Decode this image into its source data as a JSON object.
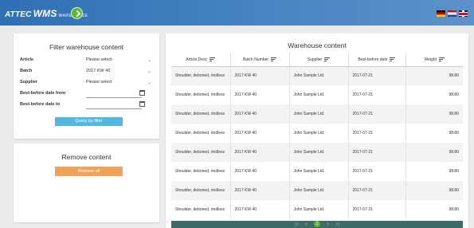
{
  "header": {
    "brand": "ATTEC",
    "brand2": "WMS",
    "brand_sub": "WAREHOUSE",
    "colors": {
      "bar": "#2f6fb3",
      "nav_button": "#5cb82f"
    },
    "languages": [
      "de",
      "nl",
      "uk"
    ]
  },
  "filter": {
    "title": "Filter warehouse content",
    "fields": [
      {
        "label": "Article",
        "value": "Please select",
        "type": "select"
      },
      {
        "label": "Batch",
        "value": "2017 KW 40",
        "type": "select"
      },
      {
        "label": "Supplier",
        "value": "Please select",
        "type": "select"
      },
      {
        "label": "Best-before date from",
        "value": "",
        "type": "date"
      },
      {
        "label": "Best-before date to",
        "value": "",
        "type": "date"
      }
    ],
    "query_button": "Query by filter",
    "button_color": "#52b8df"
  },
  "remove": {
    "title": "Remove content",
    "button": "Remove all",
    "button_color": "#f2a15a"
  },
  "table": {
    "title": "Warehouse content",
    "columns": [
      "Article Desc",
      "Batch Number",
      "Supplier",
      "Best-before date",
      "Weight"
    ],
    "rows": [
      [
        "Shoulder, deboned, rindless",
        "2017 KW 40",
        "John Sample Ltd.",
        "2017-07-21",
        "98.80"
      ],
      [
        "Shoulder, deboned, rindless",
        "2017 KW 40",
        "John Sample Ltd.",
        "2017-07-21",
        "98.80"
      ],
      [
        "Shoulder, deboned, rindless",
        "2017 KW 40",
        "John Sample Ltd.",
        "2017-07-21",
        "98.80"
      ],
      [
        "Shoulder, deboned, rindless",
        "2017 KW 40",
        "John Sample Ltd.",
        "2017-07-21",
        "98.80"
      ],
      [
        "Shoulder, deboned, rindless",
        "2017 KW 40",
        "John Sample Ltd.",
        "2017-07-21",
        "98.80"
      ],
      [
        "Shoulder, deboned, rindless",
        "2017 KW 40",
        "John Sample Ltd.",
        "2017-07-21",
        "98.80"
      ],
      [
        "Shoulder, deboned, rindless",
        "2017 KW 40",
        "John Sample Ltd.",
        "2017-07-21",
        "98.80"
      ],
      [
        "Shoulder, deboned, rindless",
        "2017 KW 40",
        "John Sample Ltd.",
        "2017-07-21",
        "98.80"
      ]
    ]
  },
  "pager": {
    "first": "|<",
    "prev": "<",
    "current": "1",
    "next": ">",
    "last": ">|",
    "color": "#3f6b66"
  }
}
